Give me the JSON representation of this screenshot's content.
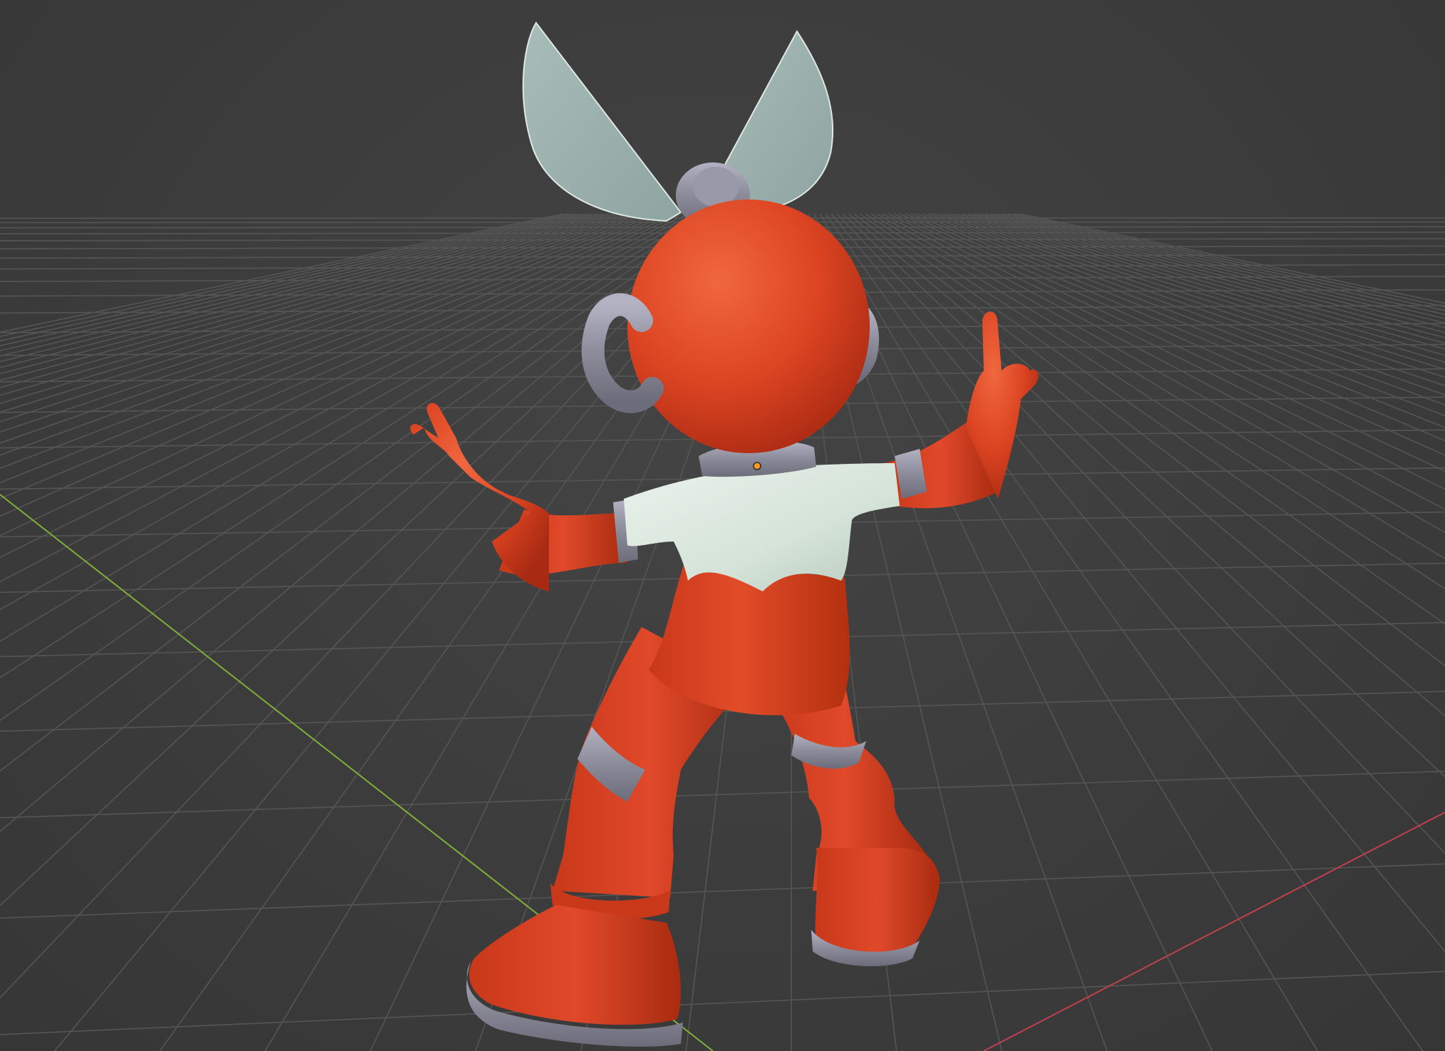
{
  "viewport": {
    "background_color": "#3d3d3d",
    "grid_color": "#555555",
    "x_axis_color": "#c0404e",
    "y_axis_color": "#7fae3a"
  },
  "character": {
    "body_color": "#e04a26",
    "shirt_color": "#d9e6dc",
    "metal_color": "#8f8e9c",
    "propeller_color": "#9bb1ad"
  },
  "origin_marker": {
    "color": "#ff9a1a"
  }
}
